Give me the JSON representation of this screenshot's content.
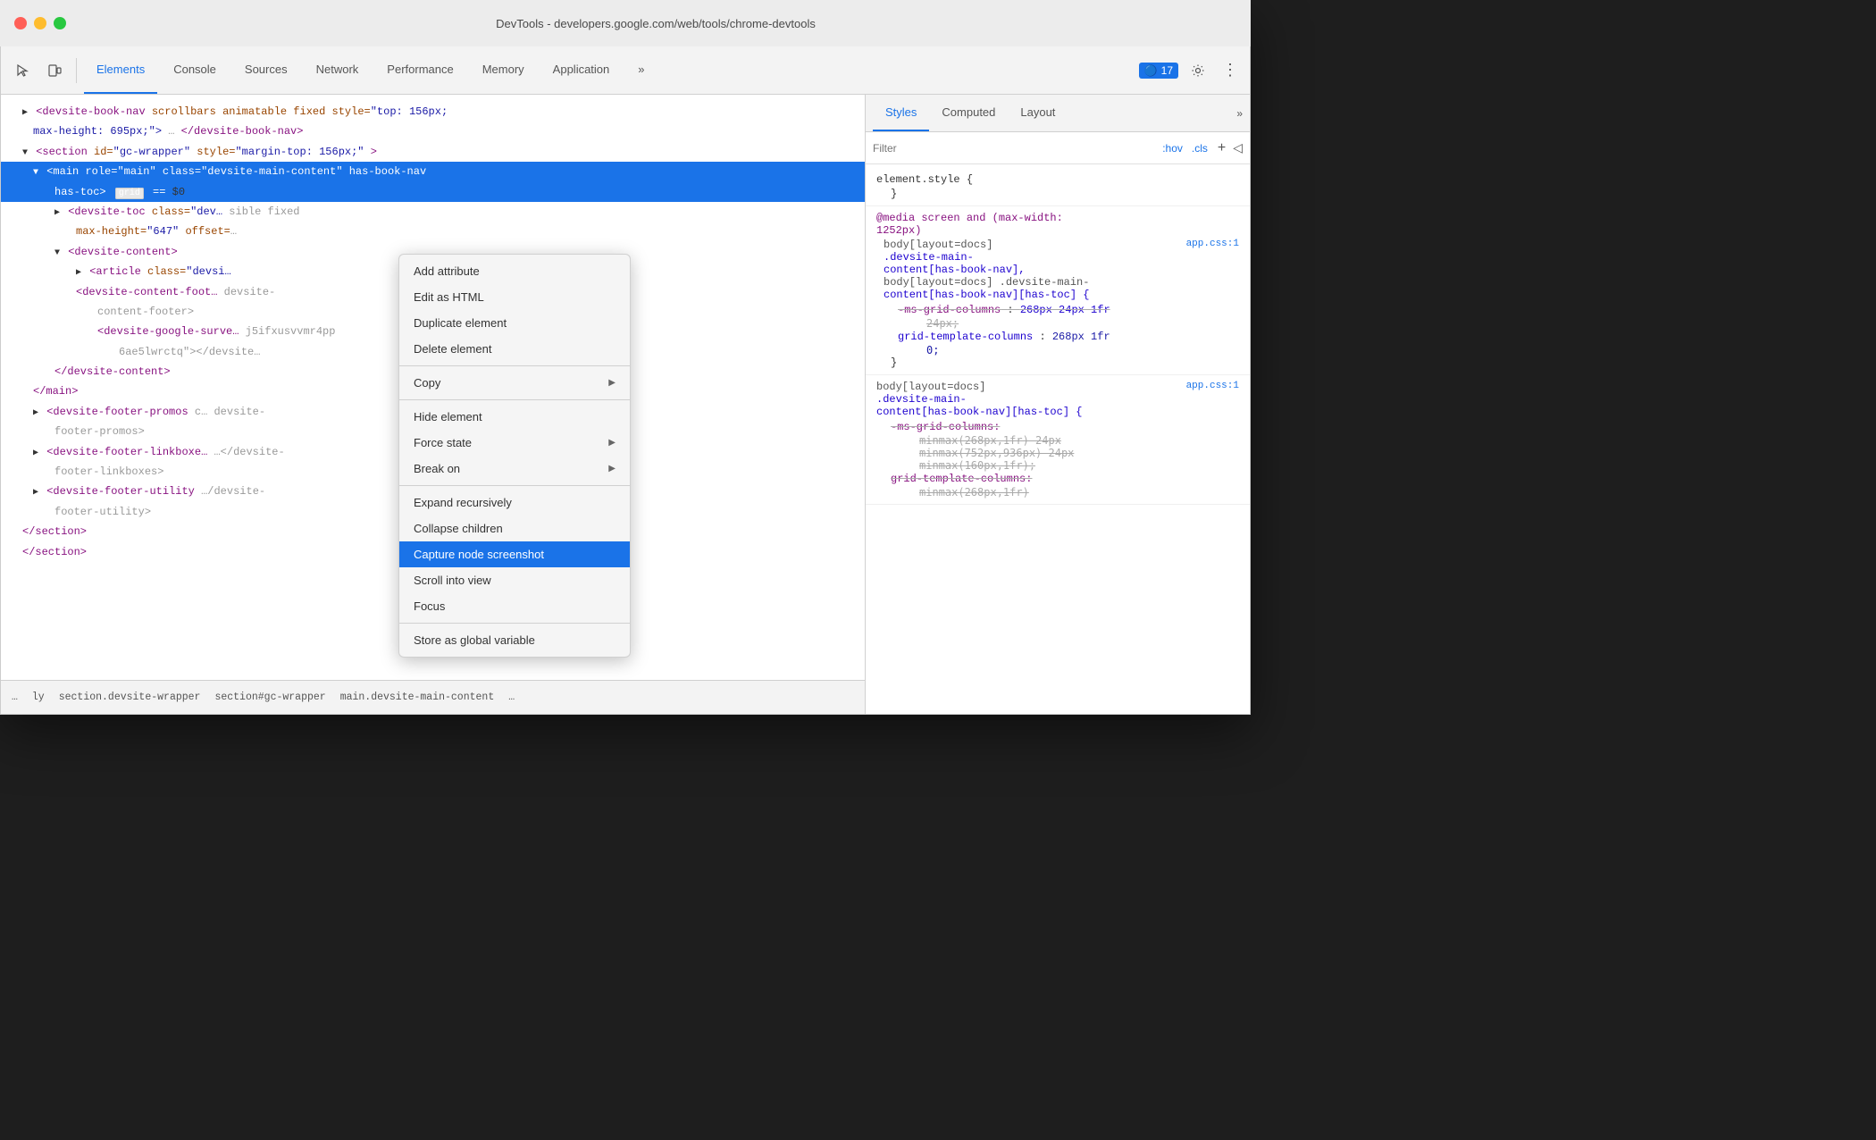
{
  "titleBar": {
    "title": "DevTools - developers.google.com/web/tools/chrome-devtools"
  },
  "toolbar": {
    "tabs": [
      {
        "label": "Elements",
        "active": true
      },
      {
        "label": "Console",
        "active": false
      },
      {
        "label": "Sources",
        "active": false
      },
      {
        "label": "Network",
        "active": false
      },
      {
        "label": "Performance",
        "active": false
      },
      {
        "label": "Memory",
        "active": false
      },
      {
        "label": "Application",
        "active": false
      }
    ],
    "more_label": "»",
    "badge_count": "17",
    "settings_label": "⚙",
    "more_menu_label": "⋮"
  },
  "elements": {
    "lines": [
      {
        "text": "▶ <devsite-book-nav scrollbars animatable fixed style=\"top: 156px; max-height: 695px;\">…</devsite-book-nav>",
        "indent": 0
      },
      {
        "text": "▼ <section id=\"gc-wrapper\" style=\"margin-top: 156px;\">",
        "indent": 0
      },
      {
        "text": "▼ <main role=\"main\" class=\"devsite-main-content\" has-book-nav has-toc> grid == $0",
        "indent": 1,
        "selected": true
      },
      {
        "text": "▶ <devsite-toc class=\"dev… sible fixed max-height=\"647\" offset=…",
        "indent": 2
      },
      {
        "text": "▼ <devsite-content>",
        "indent": 2
      },
      {
        "text": "▶ <article class=\"devsi…",
        "indent": 3
      },
      {
        "text": "<devsite-content-foot… devsite- content-footer>",
        "indent": 3
      },
      {
        "text": "<devsite-google-surve… j5ifxusvvmr4pp 6ae5lwrctq\"></devsite…",
        "indent": 4
      },
      {
        "text": "</devsite-content>",
        "indent": 2
      },
      {
        "text": "</main>",
        "indent": 1
      },
      {
        "text": "▶ <devsite-footer-promos c… devsite- footer-promos>",
        "indent": 1
      },
      {
        "text": "▶ <devsite-footer-linkboxe… …</devsite- footer-linkboxes>",
        "indent": 1
      },
      {
        "text": "▶ <devsite-footer-utility …/devsite- footer-utility>",
        "indent": 1
      },
      {
        "text": "</section>",
        "indent": 0
      },
      {
        "text": "</section>",
        "indent": 0
      }
    ]
  },
  "contextMenu": {
    "items": [
      {
        "label": "Add attribute",
        "hasArrow": false,
        "highlighted": false
      },
      {
        "label": "Edit as HTML",
        "hasArrow": false,
        "highlighted": false
      },
      {
        "label": "Duplicate element",
        "hasArrow": false,
        "highlighted": false
      },
      {
        "label": "Delete element",
        "hasArrow": false,
        "highlighted": false
      },
      {
        "divider": true
      },
      {
        "label": "Copy",
        "hasArrow": true,
        "highlighted": false
      },
      {
        "divider": true
      },
      {
        "label": "Hide element",
        "hasArrow": false,
        "highlighted": false
      },
      {
        "label": "Force state",
        "hasArrow": true,
        "highlighted": false
      },
      {
        "label": "Break on",
        "hasArrow": true,
        "highlighted": false
      },
      {
        "divider": true
      },
      {
        "label": "Expand recursively",
        "hasArrow": false,
        "highlighted": false
      },
      {
        "label": "Collapse children",
        "hasArrow": false,
        "highlighted": false
      },
      {
        "label": "Capture node screenshot",
        "hasArrow": false,
        "highlighted": true
      },
      {
        "label": "Scroll into view",
        "hasArrow": false,
        "highlighted": false
      },
      {
        "label": "Focus",
        "hasArrow": false,
        "highlighted": false
      },
      {
        "divider": true
      },
      {
        "label": "Store as global variable",
        "hasArrow": false,
        "highlighted": false
      }
    ]
  },
  "breadcrumb": {
    "items": [
      "…",
      "ly",
      "section.devsite-wrapper",
      "section#gc-wrapper",
      "main.devsite-main-content",
      "…"
    ]
  },
  "rightPanel": {
    "tabs": [
      {
        "label": "Styles",
        "active": true
      },
      {
        "label": "Computed",
        "active": false
      },
      {
        "label": "Layout",
        "active": false
      }
    ],
    "more_label": "»",
    "filter": {
      "placeholder": "Filter",
      "hov_label": ":hov",
      "cls_label": ".cls"
    },
    "styles": [
      {
        "selector": "element.style {",
        "closing": "}",
        "props": []
      },
      {
        "at_rule": "@media screen and (max-width: 1252px)",
        "selector": "body[layout=docs] .devsite-main-content[has-book-nav], body[layout=docs] .devsite-main-content[has-book-nav][has-toc] {",
        "source": "app.css:1",
        "closing": "}",
        "props": [
          {
            "name": "-ms-grid-columns",
            "value": "268px 24px 1fr 24px;",
            "strikethrough": true
          },
          {
            "name": "grid-template-columns",
            "value": "268px 1fr 0;",
            "strikethrough": false,
            "highlight": true
          }
        ]
      },
      {
        "selector": "body[layout=docs] .devsite-main-content[has-book-nav][has-toc] {",
        "source": "app.css:1",
        "closing": "}",
        "props": [
          {
            "name": "-ms-grid-columns",
            "value": "minmax(268px,1fr) 24px minmax(752px,936px) 24px minmax(160px,1fr);",
            "strikethrough": true
          },
          {
            "name": "grid-template-columns",
            "value": "minmax(268px,1fr)",
            "strikethrough": true
          }
        ]
      }
    ]
  }
}
